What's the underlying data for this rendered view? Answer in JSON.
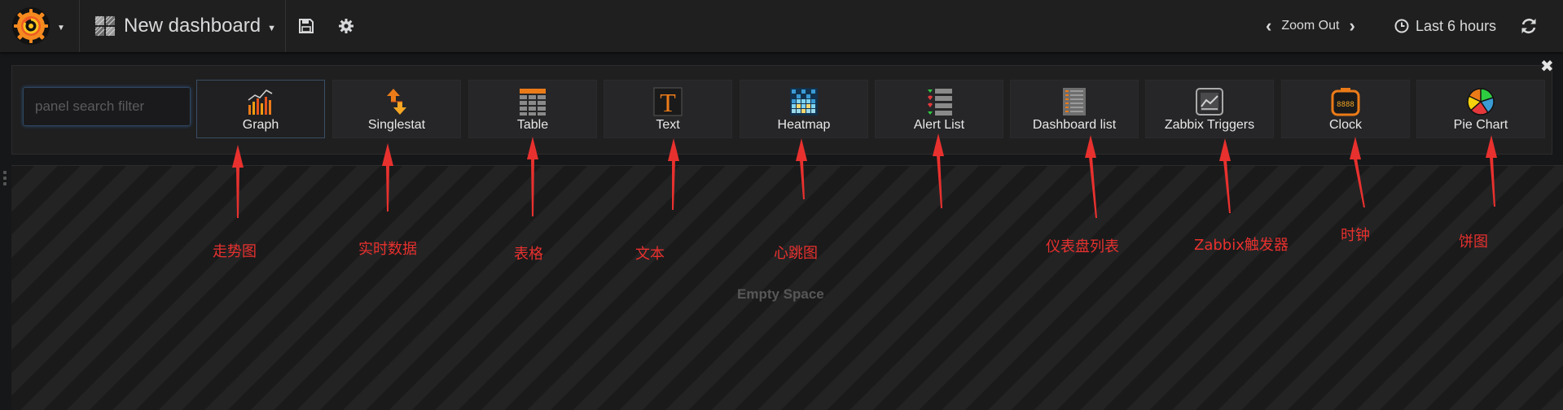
{
  "navbar": {
    "dashboard_title": "New dashboard",
    "zoom_out_label": "Zoom Out",
    "time_range_label": "Last 6 hours"
  },
  "picker": {
    "search_placeholder": "panel search filter",
    "panels": [
      {
        "label": "Graph",
        "icon": "graph-icon",
        "active": true
      },
      {
        "label": "Singlestat",
        "icon": "singlestat-icon"
      },
      {
        "label": "Table",
        "icon": "table-icon"
      },
      {
        "label": "Text",
        "icon": "text-icon"
      },
      {
        "label": "Heatmap",
        "icon": "heatmap-icon"
      },
      {
        "label": "Alert List",
        "icon": "alert-list-icon"
      },
      {
        "label": "Dashboard list",
        "icon": "dashboard-list-icon"
      },
      {
        "label": "Zabbix Triggers",
        "icon": "zabbix-triggers-icon"
      },
      {
        "label": "Clock",
        "icon": "clock-icon"
      },
      {
        "label": "Pie Chart",
        "icon": "pie-chart-icon"
      }
    ]
  },
  "empty_space_label": "Empty Space",
  "annotations": [
    "走势图",
    "实时数据",
    "表格",
    "文本",
    "心跳图",
    "仪表盘列表",
    "Zabbix触发器",
    "时钟",
    "饼图"
  ],
  "colors": {
    "accent_orange": "#eb7b18",
    "annotation_red": "#e8312e",
    "background": "#161719"
  }
}
